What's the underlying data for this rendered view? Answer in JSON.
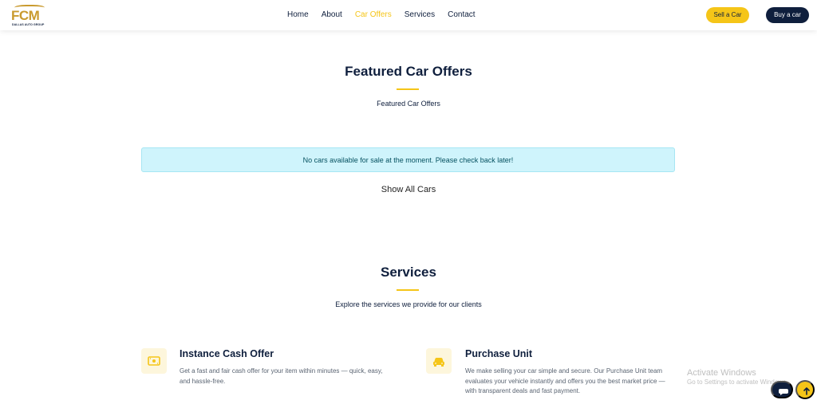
{
  "brand": {
    "logo_text": "FCM",
    "logo_subtext": "DALLAS AUTO GROUP"
  },
  "nav": {
    "links": [
      "Home",
      "About",
      "Car Offers",
      "Services",
      "Contact"
    ],
    "active": "Car Offers",
    "sell_label": "Sell a Car",
    "buy_label": "Buy a car"
  },
  "featured": {
    "title": "Featured Car Offers",
    "subtitle": "Featured Car Offers",
    "alert": "No cars available for sale at the moment. Please check back later!",
    "show_all": "Show All Cars"
  },
  "services": {
    "title": "Services",
    "subtitle": "Explore the services we provide for our clients",
    "items": [
      {
        "icon": "cash-icon",
        "title": "Instance Cash Offer",
        "description": "Get a fast and fair cash offer for your item within minutes — quick, easy, and hassle-free."
      },
      {
        "icon": "car-icon",
        "title": "Purchase Unit",
        "description": "We make selling your car simple and secure. Our Purchase Unit team evaluates your vehicle instantly and offers you the best market price — with transparent deals and fast payment."
      }
    ]
  },
  "watermark": {
    "line1": "Activate Windows",
    "line2": "Go to Settings to activate Windows."
  },
  "colors": {
    "accent": "#f5c518",
    "navy": "#0f1f3d",
    "alert_bg": "#cff4fc"
  }
}
